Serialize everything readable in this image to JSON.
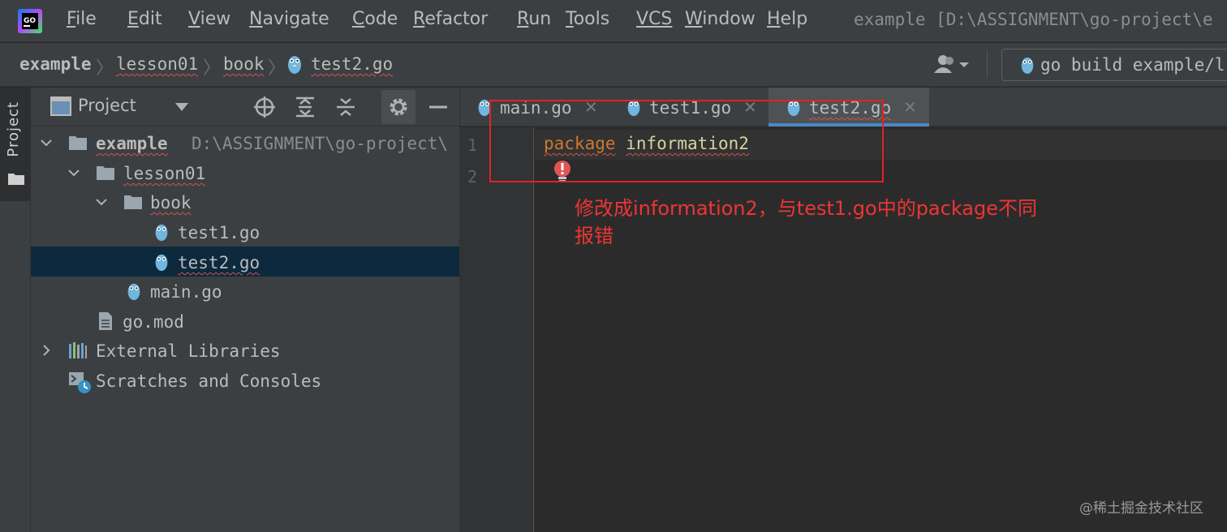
{
  "menubar": {
    "items": [
      {
        "mnemonic": "F",
        "rest": "ile"
      },
      {
        "mnemonic": "E",
        "rest": "dit"
      },
      {
        "mnemonic": "V",
        "rest": "iew"
      },
      {
        "mnemonic": "N",
        "rest": "avigate"
      },
      {
        "mnemonic": "C",
        "rest": "ode"
      },
      {
        "mnemonic": "R",
        "rest": "efactor"
      },
      {
        "mnemonic": "R",
        "rest": "un"
      },
      {
        "mnemonic": "T",
        "rest": "ools"
      },
      {
        "mnemonic": "",
        "rest": "VCS"
      },
      {
        "mnemonic": "W",
        "rest": "indow"
      },
      {
        "mnemonic": "H",
        "rest": "elp"
      }
    ],
    "window_title": "example [D:\\ASSIGNMENT\\go-project\\e"
  },
  "navbar": {
    "breadcrumbs": [
      "example",
      "lesson01",
      "book",
      "test2.go"
    ],
    "run_config": "go build example/l"
  },
  "tool_strip": {
    "label": "Project"
  },
  "project_panel": {
    "title": "Project",
    "tree": [
      {
        "label": "example",
        "hint": "D:\\ASSIGNMENT\\go-project\\",
        "type": "folder",
        "expanded": true
      },
      {
        "label": "lesson01",
        "type": "folder",
        "expanded": true
      },
      {
        "label": "book",
        "type": "folder",
        "expanded": true
      },
      {
        "label": "test1.go",
        "type": "go-file"
      },
      {
        "label": "test2.go",
        "type": "go-file",
        "selected": true
      },
      {
        "label": "main.go",
        "type": "go-file"
      },
      {
        "label": "go.mod",
        "type": "mod-file"
      },
      {
        "label": "External Libraries",
        "type": "libraries",
        "expanded": false
      },
      {
        "label": "Scratches and Consoles",
        "type": "scratches"
      }
    ]
  },
  "editor": {
    "tabs": [
      {
        "label": "main.go",
        "active": false
      },
      {
        "label": "test1.go",
        "active": false
      },
      {
        "label": "test2.go",
        "active": true
      }
    ],
    "line_numbers": [
      "1",
      "2"
    ],
    "code": {
      "keyword": "package",
      "name": "information2"
    }
  },
  "annotation": {
    "line1": "修改成information2，与test1.go中的package不同",
    "line2": "报错"
  },
  "watermark": "@稀土掘金技术社区",
  "colors": {
    "accent_tab": "#4a88c7",
    "keyword": "#cc7832",
    "annotation_red": "#f03434",
    "selection": "#0d293e"
  }
}
